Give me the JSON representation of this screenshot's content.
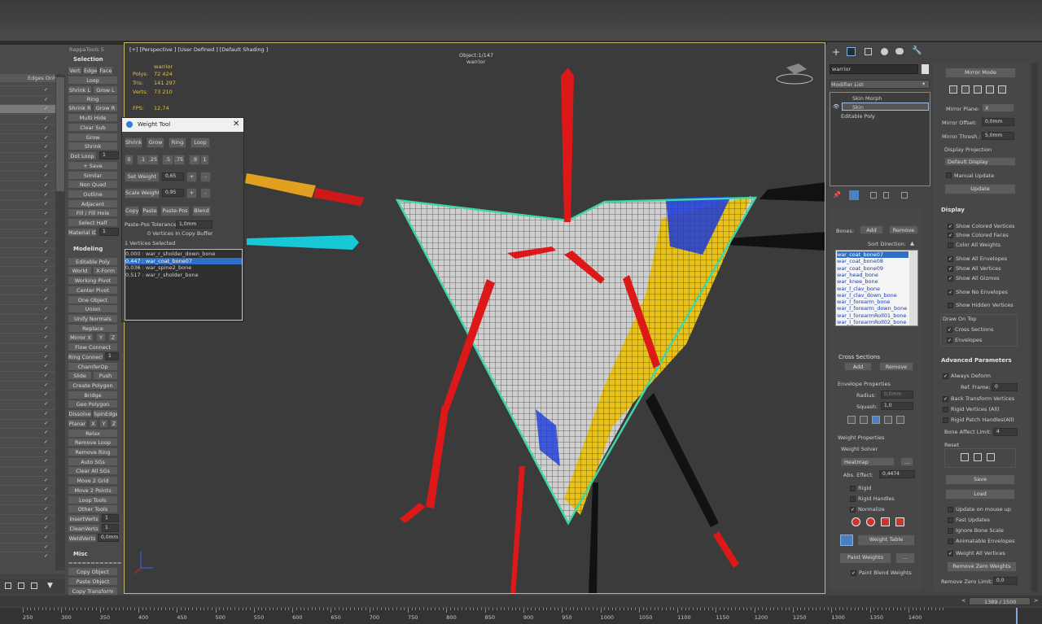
{
  "top_bar": {},
  "left_list": {
    "header": "Edges Only",
    "rows": [
      "",
      "",
      "",
      "",
      "",
      "",
      "",
      "",
      "",
      "",
      "",
      "",
      "",
      "",
      "",
      "",
      "",
      "",
      "",
      "",
      "",
      "",
      "",
      "",
      "",
      "",
      "",
      "",
      "",
      "",
      "",
      "",
      "",
      "",
      "",
      "",
      "",
      "",
      ""
    ]
  },
  "rappa": {
    "title": "RappaTools 5",
    "sel_title": "Selection",
    "vert": "Vert",
    "edge": "Edge",
    "face": "Face",
    "loop": "Loop",
    "shrinkL": "Shrink L",
    "growL": "Grow L",
    "ring": "Ring",
    "shrinkR": "Shrink R",
    "growR": "Grow R",
    "multihide": "Multi Hide",
    "clearsub": "Clear Sub",
    "grow": "Grow",
    "shrink": "Shrink",
    "dotloop": "Dot Loop",
    "dotloop_val": "1",
    "save": "+ Save",
    "similar": "Similar",
    "nonquad": "Non Quad",
    "outline": "Outline",
    "adjacent": "Adjacent",
    "fillhole": "Fill / Fill Hole",
    "selecthalf": "Select Half",
    "matid": "Material ID",
    "matid_val": "1",
    "mod_title": "Modeling",
    "editpoly": "Editable Poly",
    "world": "World",
    "xform": "X-Form",
    "wpivot": "Working Pivot",
    "cpivot": "Center Pivot",
    "oneobj": "One Object",
    "union": "Union",
    "unify": "Unify Normals",
    "replace": "Replace",
    "mirrorx": "Mirror X",
    "y": "Y",
    "z": "Z",
    "flow": "Flow Connect",
    "ringconn": "Ring Connect",
    "ringconn_val": "1",
    "chamfer": "ChamferOp",
    "slide": "Slide",
    "push": "Push",
    "createpoly": "Create Polygon",
    "bridge": "Bridge",
    "geopoly": "Geo Polygon",
    "dissolve": "Dissolve",
    "spinedge": "SpinEdge",
    "planar": "Planar",
    "x": "X",
    "relax": "Relax",
    "removeloop": "Remove Loop",
    "removering": "Remove Ring",
    "autosg": "Auto SGs",
    "clearsg": "Clear All SGs",
    "move2grid": "Move 2 Grid",
    "move2pts": "Move 2 Points",
    "looptools": "Loop Tools",
    "othertools": "Other Tools",
    "insertverts": "InsertVerts",
    "insert_val": "1",
    "cleanverts": "CleanVerts",
    "clean_val": "1",
    "weldverts": "WeldVerts",
    "weld_val": "0,0mm",
    "misc_title": "Misc",
    "sep": "============",
    "copyobj": "Copy Object",
    "pasteobj": "Paste Object",
    "copytrans": "Copy Transform"
  },
  "viewport": {
    "label": "[+] [Perspective ] [User Defined ] [Default Shading ]",
    "object_count": "Object:1/147",
    "object_name": "warrior",
    "stats_name": "warrior",
    "polys_l": "Polys:",
    "polys": "72 424",
    "tris_l": "Tris:",
    "tris": "141 297",
    "verts_l": "Verts:",
    "verts": "73 210",
    "fps_l": "FPS:",
    "fps": "12,74"
  },
  "weight_tool": {
    "title": "Weight Tool",
    "shrink": "Shrink",
    "grow": "Grow",
    "ring": "Ring",
    "loop": "Loop",
    "presets": [
      "0",
      ".1",
      ".25",
      ".5",
      ".75",
      ".9",
      "1"
    ],
    "set_weight": "Set Weight",
    "set_val": "0,65",
    "scale_weight": "Scale Weight",
    "scale_val": "0,95",
    "plus": "+",
    "minus": "-",
    "copy": "Copy",
    "paste": "Paste",
    "pastepos": "Paste-Pos",
    "blend": "Blend",
    "tol_label": "Paste-Pos Tolerance",
    "tol_val": "1,0mm",
    "copy_buffer": "0 Vertices In Copy Buffer",
    "selected": "1 Vertices Selected",
    "list": [
      "0,000 : war_r_sholder_down_bone",
      "0,447 : war_coat_bone07",
      "0,036 : war_spine2_bone",
      "0,517 : war_r_sholder_bone"
    ]
  },
  "modify": {
    "obj_name": "warrior",
    "modifier_list": "Modifier List",
    "stack": [
      "Skin Morph",
      "Skin",
      "Editable Poly"
    ],
    "bones_label": "Bones:",
    "add": "Add",
    "remove": "Remove",
    "sort": "Sort Direction:",
    "bones": [
      "war_coat_bone07",
      "war_coat_bone08",
      "war_coat_bone09",
      "war_head_bone",
      "war_knee_bone",
      "war_l_clav_bone",
      "war_l_clav_down_bone",
      "war_l_forearm_bone",
      "war_l_forearm_down_bone",
      "war_l_forearmRoll01_bone",
      "war_l_forearmRoll02_bone"
    ],
    "cross_title": "Cross Sections",
    "cs_add": "Add",
    "cs_remove": "Remove",
    "env_title": "Envelope Properties",
    "radius": "Radius:",
    "radius_val": "0,0mm",
    "squash": "Squash:",
    "squash_val": "1,0",
    "wp_title": "Weight Properties",
    "solver": "Weight Solver",
    "heatmap": "Heatmap",
    "dots": "...",
    "abs": "Abs. Effect:",
    "abs_val": "0,4474",
    "rigid": "Rigid",
    "rigidh": "Rigid Handles",
    "normalize": "Normalize",
    "weight_table": "Weight Table",
    "paint_weights": "Paint Weights",
    "paint_blend": "Paint Blend Weights"
  },
  "mirror": {
    "mirror_mode": "Mirror Mode",
    "plane": "Mirror Plane:",
    "plane_val": "X",
    "offset": "Mirror Offset:",
    "offset_val": "0,0mm",
    "thresh": "Mirror Thresh.:",
    "thresh_val": "5,0mm",
    "disp_proj": "Display Projection",
    "default_disp": "Default Display",
    "manual": "Manual Update",
    "update": "Update"
  },
  "display": {
    "title": "Display",
    "opts": [
      "Show Colored Vertices",
      "Show Colored Faces",
      "Color All Weights",
      "Show All Envelopes",
      "Show All Vertices",
      "Show All Gizmos",
      "Show No Envelopes",
      "Show Hidden Vertices"
    ],
    "draw_on_top": "Draw On Top",
    "cross": "Cross Sections",
    "envelopes": "Envelopes"
  },
  "advanced": {
    "title": "Advanced Parameters",
    "always": "Always Deform",
    "ref": "Ref. Frame:",
    "ref_val": "0",
    "back": "Back Transform Vertices",
    "rigidv": "Rigid Vertices (All)",
    "rigidp": "Rigid Patch Handles(All)",
    "bone_limit": "Bone Affect Limit:",
    "bone_val": "4",
    "reset": "Reset",
    "save": "Save",
    "load": "Load",
    "upd_mouse": "Update on mouse up",
    "fast": "Fast Updates",
    "ignore": "Ignore Bone Scale",
    "anim_env": "Animatable Envelopes",
    "weight_all": "Weight All Vertices",
    "remove_zero": "Remove Zero Weights",
    "remove_limit": "Remove Zero Limit:",
    "remove_val": "0,0"
  },
  "timeline": {
    "frame": "1389 / 1500",
    "ticks": [
      "250",
      "300",
      "350",
      "400",
      "450",
      "500",
      "550",
      "600",
      "650",
      "700",
      "750",
      "800",
      "850",
      "900",
      "950",
      "1000",
      "1050",
      "1100",
      "1150",
      "1200",
      "1250",
      "1300",
      "1350",
      "1400"
    ]
  }
}
